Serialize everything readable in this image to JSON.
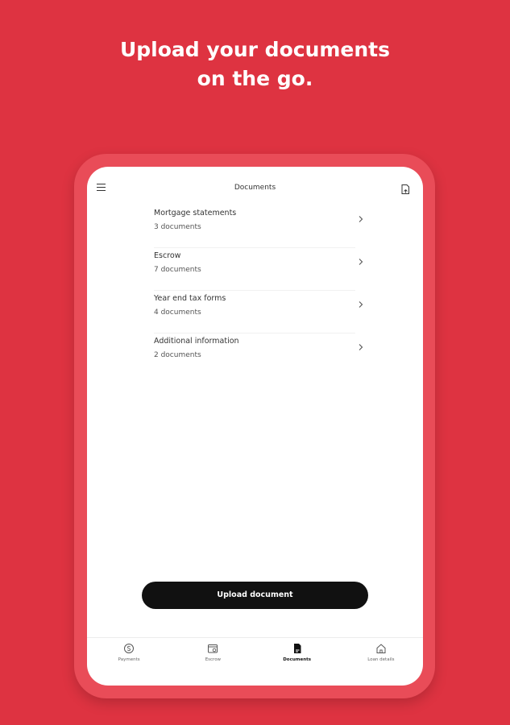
{
  "headline": {
    "line1": "Upload your documents",
    "line2": "on the go."
  },
  "colors": {
    "background": "#de3341",
    "primary_button": "#111111"
  },
  "screen": {
    "title": "Documents",
    "menu_icon": "hamburger-menu-icon",
    "action_icon": "document-upload-icon"
  },
  "documents": [
    {
      "name": "Mortgage statements",
      "count": "3 documents"
    },
    {
      "name": "Escrow",
      "count": "7 documents"
    },
    {
      "name": "Year end tax forms",
      "count": "4 documents"
    },
    {
      "name": "Additional information",
      "count": "2 documents"
    }
  ],
  "upload_button": {
    "label": "Upload document"
  },
  "bottom_nav": [
    {
      "label": "Payments",
      "icon": "payments-icon",
      "active": false
    },
    {
      "label": "Escrow",
      "icon": "escrow-icon",
      "active": false
    },
    {
      "label": "Documents",
      "icon": "documents-icon",
      "active": true
    },
    {
      "label": "Loan details",
      "icon": "home-icon",
      "active": false
    }
  ]
}
